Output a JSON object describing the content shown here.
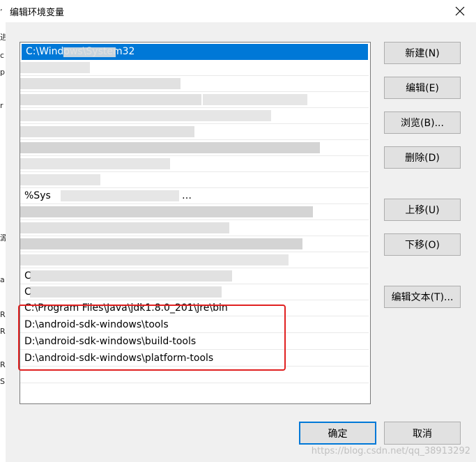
{
  "background_window": {
    "fragments": [
      "’",
      "进",
      "c",
      "p",
      "r",
      "源",
      "a",
      "R",
      "R",
      "R",
      "S"
    ]
  },
  "dialog": {
    "title": "编辑环境变量",
    "close_icon": "close-icon"
  },
  "path_list": {
    "selected_entry": "C:\\Windows\\System32",
    "partial_entries": {
      "row_9": "%Sys",
      "row_9_tail": "…",
      "row_13": "C",
      "row_14": "C"
    },
    "entries": [
      "C:\\Program Files\\Java\\jdk1.8.0_201\\jre\\bin",
      "D:\\android-sdk-windows\\tools",
      "D:\\android-sdk-windows\\build-tools",
      "D:\\android-sdk-windows\\platform-tools"
    ]
  },
  "buttons": {
    "new": "新建(N)",
    "edit": "编辑(E)",
    "browse": "浏览(B)...",
    "delete": "删除(D)",
    "move_up": "上移(U)",
    "move_down": "下移(O)",
    "edit_text": "编辑文本(T)...",
    "ok": "确定",
    "cancel": "取消"
  },
  "watermark": "https://blog.csdn.net/qq_38913292"
}
